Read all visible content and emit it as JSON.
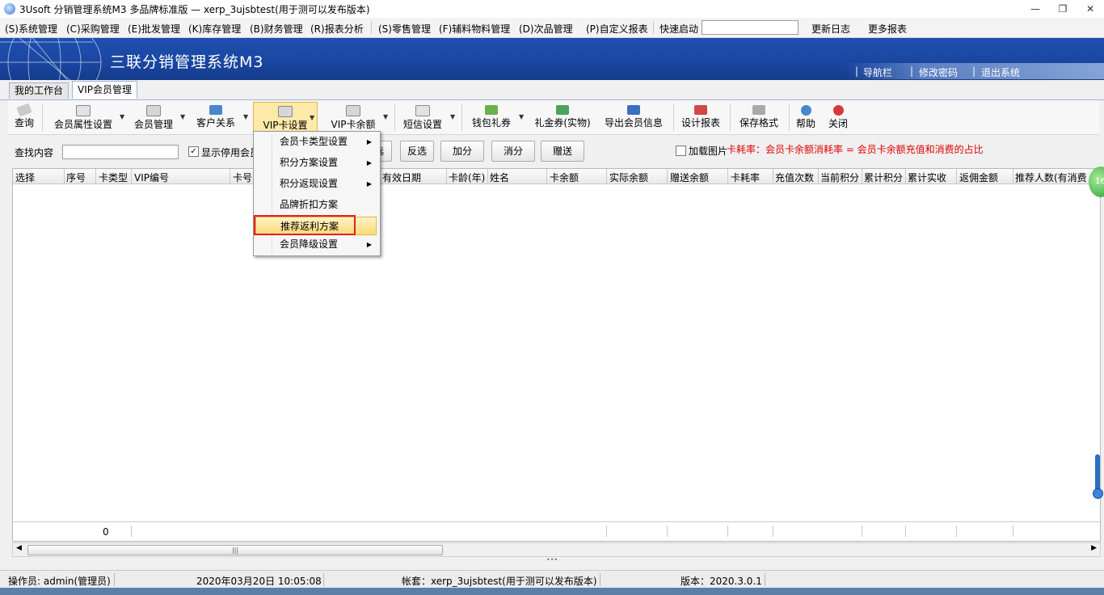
{
  "window": {
    "title": "3Usoft 分销管理系统M3 多品牌标准版 — xerp_3ujsbtest(用于测可以发布版本)"
  },
  "menubar": {
    "items": [
      "(S)系统管理",
      "(C)采购管理",
      "(E)批发管理",
      "(K)库存管理",
      "(B)财务管理",
      "(R)报表分析",
      "(S)零售管理",
      "(F)辅料物料管理",
      "(D)次品管理",
      "(P)自定义报表"
    ],
    "quick_start_label": "快速启动",
    "quick_start_value": "",
    "update_log": "更新日志",
    "more_reports": "更多报表"
  },
  "banner": {
    "brand": "三联分销管理系统M3",
    "links": [
      "导航栏",
      "修改密码",
      "退出系统"
    ]
  },
  "tabs": [
    "我的工作台",
    "VIP会员管理"
  ],
  "toolbar": {
    "items": [
      "查询",
      "会员属性设置",
      "会员管理",
      "客户关系",
      "VIP卡设置",
      "VIP卡余额",
      "短信设置",
      "钱包礼券",
      "礼金券(实物)",
      "导出会员信息",
      "设计报表",
      "保存格式",
      "帮助",
      "关闭"
    ]
  },
  "filter": {
    "search_label": "查找内容",
    "search_value": "",
    "show_disabled_label": "显示停用会员",
    "buttons": [
      "选",
      "反选",
      "加分",
      "消分",
      "赠送"
    ],
    "load_image_label": "加载图片",
    "card_rate_note": "卡耗率：会员卡余额消耗率 =  会员卡余额充值和消费的占比"
  },
  "grid": {
    "columns": [
      "选择",
      "序号",
      "卡类型",
      "VIP编号",
      "卡号",
      "有效日期",
      "卡龄(年)",
      "姓名",
      "卡余额",
      "实际余额",
      "赠送余额",
      "卡耗率",
      "充值次数",
      "当前积分",
      "累计积分",
      "累计实收",
      "返佣金额",
      "推荐人数(有消费"
    ],
    "footer_count": "0"
  },
  "dropdown": {
    "items": [
      {
        "label": "会员卡类型设置",
        "submenu": true
      },
      {
        "label": "积分方案设置",
        "submenu": true
      },
      {
        "label": "积分返现设置",
        "submenu": true
      },
      {
        "label": "品牌折扣方案",
        "submenu": false
      },
      {
        "label": "推荐返利方案",
        "submenu": false
      },
      {
        "label": "会员降级设置",
        "submenu": true
      }
    ],
    "highlighted": "推荐返利方案"
  },
  "statusbar": {
    "operator": "操作员: admin(管理员)",
    "datetime": "2020年03月20日 10:05:08",
    "account": "帐套：xerp_3ujsbtest(用于测可以发布版本)",
    "version": "版本：2020.3.0.1"
  },
  "badge": "16",
  "colors": {
    "banner": "#1f4fb0",
    "highlight": "#fbd97a",
    "red_box": "#e32020",
    "note_red": "#e00000"
  }
}
